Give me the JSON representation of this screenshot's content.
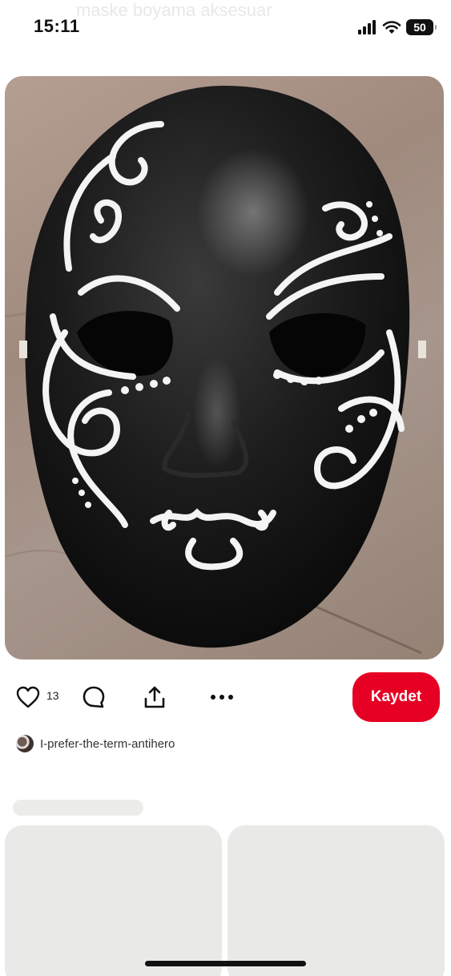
{
  "status_bar": {
    "time": "15:11",
    "battery": "50",
    "icons": [
      "cellular-signal-icon",
      "wifi-icon",
      "battery-icon"
    ]
  },
  "background_title": "maske boyama aksesuar",
  "pin": {
    "image": "black-painted-mask-with-white-swirls",
    "like_count": "13",
    "author": "I-prefer-the-term-antihero"
  },
  "actions": {
    "save_label": "Kaydet",
    "icons": [
      "heart-icon",
      "comment-icon",
      "share-icon",
      "more-icon"
    ]
  },
  "colors": {
    "accent": "#e60023",
    "skeleton": "#e9e9e7"
  }
}
